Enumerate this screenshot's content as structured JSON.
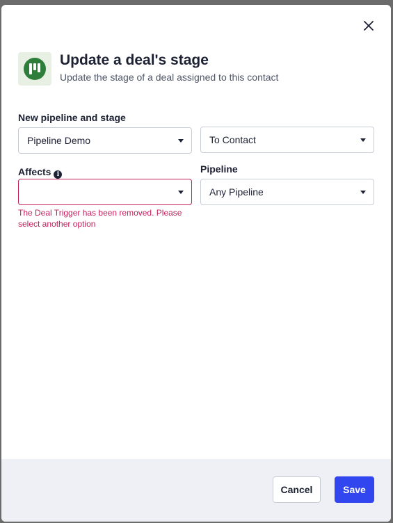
{
  "modal": {
    "title": "Update a deal's stage",
    "subtitle": "Update the stage of a deal assigned to this contact",
    "close_icon": "close-icon",
    "header_icon": "pipeline-icon"
  },
  "form": {
    "pipeline_stage_label": "New pipeline and stage",
    "pipeline_select_value": "Pipeline Demo",
    "stage_select_value": "To Contact",
    "affects_label": "Affects",
    "affects_info_icon": "info-icon",
    "affects_select_value": "",
    "affects_error": "The Deal Trigger has been removed. Please select another option",
    "pipeline_label": "Pipeline",
    "pipeline_filter_value": "Any Pipeline"
  },
  "footer": {
    "cancel_label": "Cancel",
    "save_label": "Save"
  },
  "colors": {
    "accent": "#3246f0",
    "error": "#c41e5a",
    "icon_green": "#2e7d3a"
  }
}
